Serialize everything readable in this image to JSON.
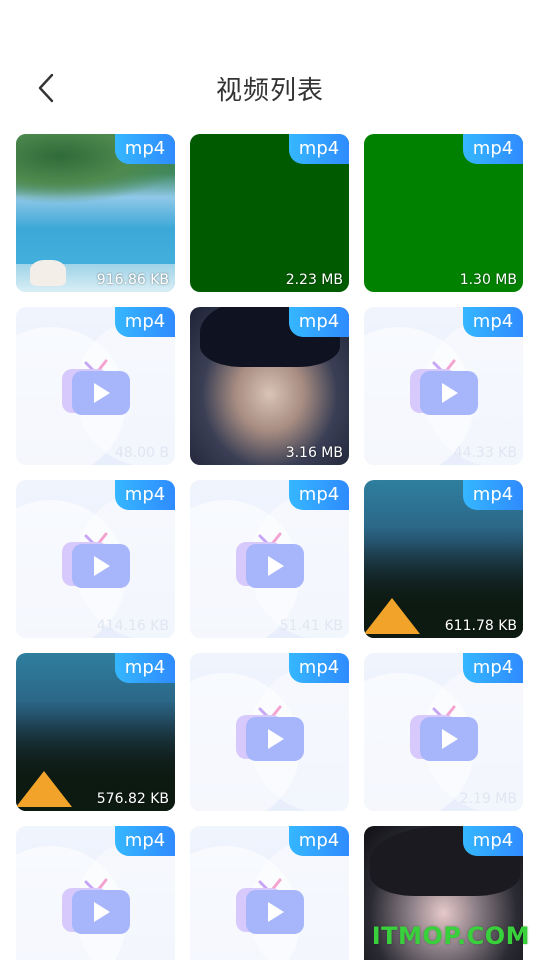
{
  "header": {
    "title": "视频列表"
  },
  "badge_label": "mp4",
  "tiles": [
    {
      "type": "image",
      "subject": "seaside tree",
      "size": "916.86 KB"
    },
    {
      "type": "image",
      "subject": "dark green",
      "size": "2.23 MB"
    },
    {
      "type": "image",
      "subject": "green",
      "size": "1.30 MB"
    },
    {
      "type": "placeholder",
      "size": "48.00 B"
    },
    {
      "type": "image",
      "subject": "portrait",
      "size": "3.16 MB"
    },
    {
      "type": "placeholder",
      "size": "44.33 KB"
    },
    {
      "type": "placeholder",
      "size": "414.16 KB"
    },
    {
      "type": "placeholder",
      "size": "51.41 KB"
    },
    {
      "type": "image",
      "subject": "night forest camp",
      "size": "611.78 KB"
    },
    {
      "type": "image",
      "subject": "night forest camp",
      "size": "576.82 KB"
    },
    {
      "type": "placeholder",
      "size": ""
    },
    {
      "type": "placeholder",
      "size": "2.19 MB"
    },
    {
      "type": "placeholder",
      "size": ""
    },
    {
      "type": "placeholder",
      "size": ""
    },
    {
      "type": "image",
      "subject": "game character",
      "size": ""
    }
  ],
  "watermark": "ITMOP.COM",
  "colors": {
    "badge_start": "#35b7ff",
    "badge_end": "#2f8bff",
    "title": "#333333"
  }
}
